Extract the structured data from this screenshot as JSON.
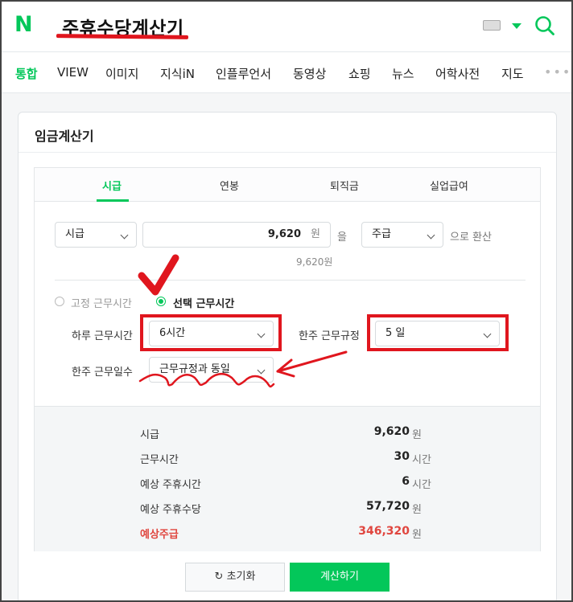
{
  "header": {
    "logo": "N",
    "query": "주휴수당계산기"
  },
  "nav": {
    "tabs": [
      "통합",
      "VIEW",
      "이미지",
      "지식iN",
      "인플루언서",
      "동영상",
      "쇼핑",
      "뉴스",
      "어학사전",
      "지도"
    ],
    "more": "•••"
  },
  "card": {
    "title": "임금계산기",
    "subtabs": [
      "시급",
      "연봉",
      "퇴직금",
      "실업급여"
    ],
    "conversion": {
      "from_select": "시급",
      "amount": "9,620",
      "amount_unit": "원",
      "particle": "을",
      "to_select": "주급",
      "suffix": "으로 환산",
      "amount_hint": "9,620원"
    },
    "mode": {
      "fixed_label": "고정 근무시간",
      "selected_label": "선택 근무시간"
    },
    "fields": {
      "daily_hours_label": "하루 근무시간",
      "daily_hours_value": "6시간",
      "weekly_rule_label": "한주 근무규정",
      "weekly_rule_value": "5 일",
      "weekly_days_label": "한주 근무일수",
      "weekly_days_value": "근무규정과 동일"
    },
    "results": [
      {
        "label": "시급",
        "value": "9,620",
        "unit": "원"
      },
      {
        "label": "근무시간",
        "value": "30",
        "unit": "시간"
      },
      {
        "label": "예상 주휴시간",
        "value": "6",
        "unit": "시간"
      },
      {
        "label": "예상 주휴수당",
        "value": "57,720",
        "unit": "원"
      },
      {
        "label": "예상주급",
        "value": "346,320",
        "unit": "원"
      }
    ],
    "buttons": {
      "reset": "초기화",
      "reset_icon": "↻",
      "calculate": "계산하기"
    }
  },
  "colors": {
    "brand": "#03c75a",
    "annotation": "#e0161e",
    "result_highlight": "#e0463f"
  }
}
